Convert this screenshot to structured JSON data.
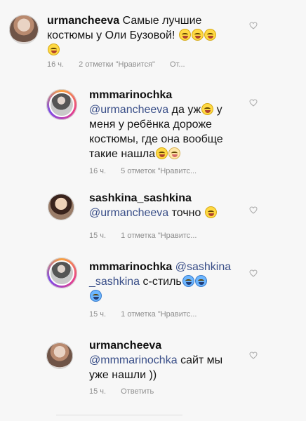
{
  "comments": [
    {
      "username": "urmancheeva",
      "text_line_1": "Самые лучшие",
      "text_line_2": "костюмы у Оли Бузовой!",
      "time": "16 ч.",
      "likes": "2 отметки \"Нравится\"",
      "action": "От..."
    },
    {
      "username": "mmmarinochka",
      "mention": "@urmancheeva",
      "text_line_1": "да уж",
      "text_line_2": "меня у ребёнка дороже",
      "text_line_3": "костюмы, где она вообще",
      "text_line_4": "такие нашла",
      "time": "16 ч.",
      "likes": "5 отметок \"Нравитс..."
    },
    {
      "username": "sashkina_sashkina",
      "mention": "@urmancheeva",
      "text": "точно",
      "time": "15 ч.",
      "likes": "1 отметка \"Нравитс..."
    },
    {
      "username": "mmmarinochka",
      "mention_part_1": "@sashkina",
      "mention_part_2": "_sashkina",
      "text": "с-стиль",
      "time": "15 ч.",
      "likes": "1 отметка \"Нравитс..."
    },
    {
      "username": "urmancheeva",
      "mention": "@mmmarinochka",
      "text_line_1": "сайт мы",
      "text_line_2": "уже нашли ))",
      "time": "15 ч.",
      "reply": "Ответить"
    }
  ],
  "icons": {
    "heart": "heart-outline-icon",
    "emoji": "emoji-face-icon"
  }
}
